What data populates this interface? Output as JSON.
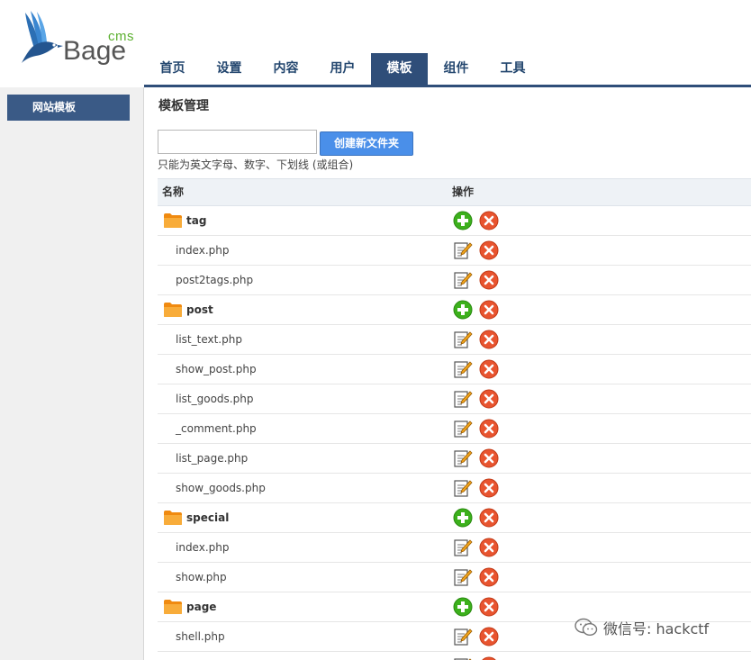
{
  "logo": {
    "cms": "cms",
    "brand": "Bage"
  },
  "nav": {
    "items": [
      {
        "label": "首页",
        "active": false
      },
      {
        "label": "设置",
        "active": false
      },
      {
        "label": "内容",
        "active": false
      },
      {
        "label": "用户",
        "active": false
      },
      {
        "label": "模板",
        "active": true
      },
      {
        "label": "组件",
        "active": false
      },
      {
        "label": "工具",
        "active": false
      }
    ]
  },
  "sidebar": {
    "items": [
      {
        "label": "网站模板"
      }
    ]
  },
  "main": {
    "title": "模板管理",
    "folder_input": {
      "value": "",
      "placeholder": ""
    },
    "create_button": "创建新文件夹",
    "hint": "只能为英文字母、数字、下划线 (或组合)",
    "table": {
      "headers": {
        "name": "名称",
        "ops": "操作"
      },
      "rows": [
        {
          "type": "folder",
          "name": "tag"
        },
        {
          "type": "file",
          "name": "index.php"
        },
        {
          "type": "file",
          "name": "post2tags.php"
        },
        {
          "type": "folder",
          "name": "post"
        },
        {
          "type": "file",
          "name": "list_text.php"
        },
        {
          "type": "file",
          "name": "show_post.php"
        },
        {
          "type": "file",
          "name": "list_goods.php"
        },
        {
          "type": "file",
          "name": "_comment.php"
        },
        {
          "type": "file",
          "name": "list_page.php"
        },
        {
          "type": "file",
          "name": "show_goods.php"
        },
        {
          "type": "folder",
          "name": "special"
        },
        {
          "type": "file",
          "name": "index.php"
        },
        {
          "type": "file",
          "name": "show.php"
        },
        {
          "type": "folder",
          "name": "page"
        },
        {
          "type": "file",
          "name": "shell.php"
        },
        {
          "type": "file",
          "name": ""
        }
      ]
    }
  },
  "icons": {
    "folder": "folder-icon",
    "add": "add-icon",
    "delete": "delete-icon",
    "edit": "edit-icon"
  },
  "colors": {
    "nav_active": "#2f4e79",
    "sidebar_item": "#3a5a86",
    "button": "#4a8fe9",
    "add_green": "#3cb01c",
    "delete_red": "#e8542f",
    "folder_orange": "#f49a1c"
  },
  "watermark": "微信号: hackctf"
}
